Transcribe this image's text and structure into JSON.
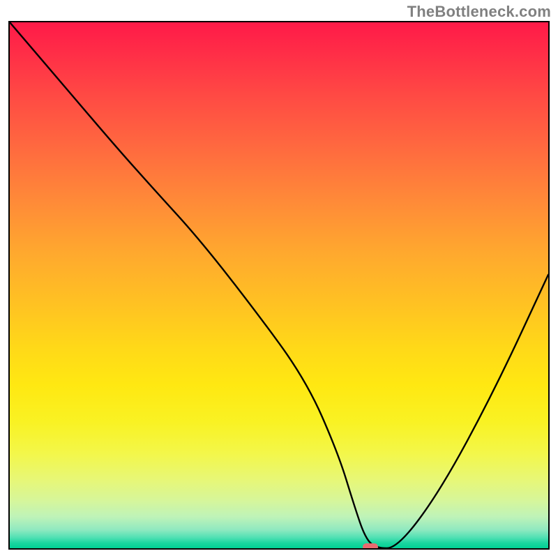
{
  "watermark": "TheBottleneck.com",
  "chart_data": {
    "type": "line",
    "title": "",
    "xlabel": "",
    "ylabel": "",
    "xlim": [
      0,
      100
    ],
    "ylim": [
      0,
      100
    ],
    "grid": false,
    "series": [
      {
        "name": "curve",
        "x": [
          0,
          10,
          20,
          27,
          35,
          45,
          55,
          61,
          64,
          66,
          68,
          72,
          80,
          90,
          100
        ],
        "y": [
          100,
          88,
          76,
          68,
          59,
          46,
          32,
          18,
          8,
          2,
          0,
          0,
          11,
          30,
          52
        ]
      }
    ],
    "marker": {
      "x": 67,
      "y": 0,
      "color": "#e86a6f"
    },
    "background": {
      "type": "vertical-gradient",
      "stops": [
        {
          "pos": 0,
          "color": "#ff1a48"
        },
        {
          "pos": 24,
          "color": "#ff6a3f"
        },
        {
          "pos": 54,
          "color": "#ffc322"
        },
        {
          "pos": 76,
          "color": "#f9f223"
        },
        {
          "pos": 94,
          "color": "#bff3b8"
        },
        {
          "pos": 100,
          "color": "#00d094"
        }
      ]
    }
  }
}
